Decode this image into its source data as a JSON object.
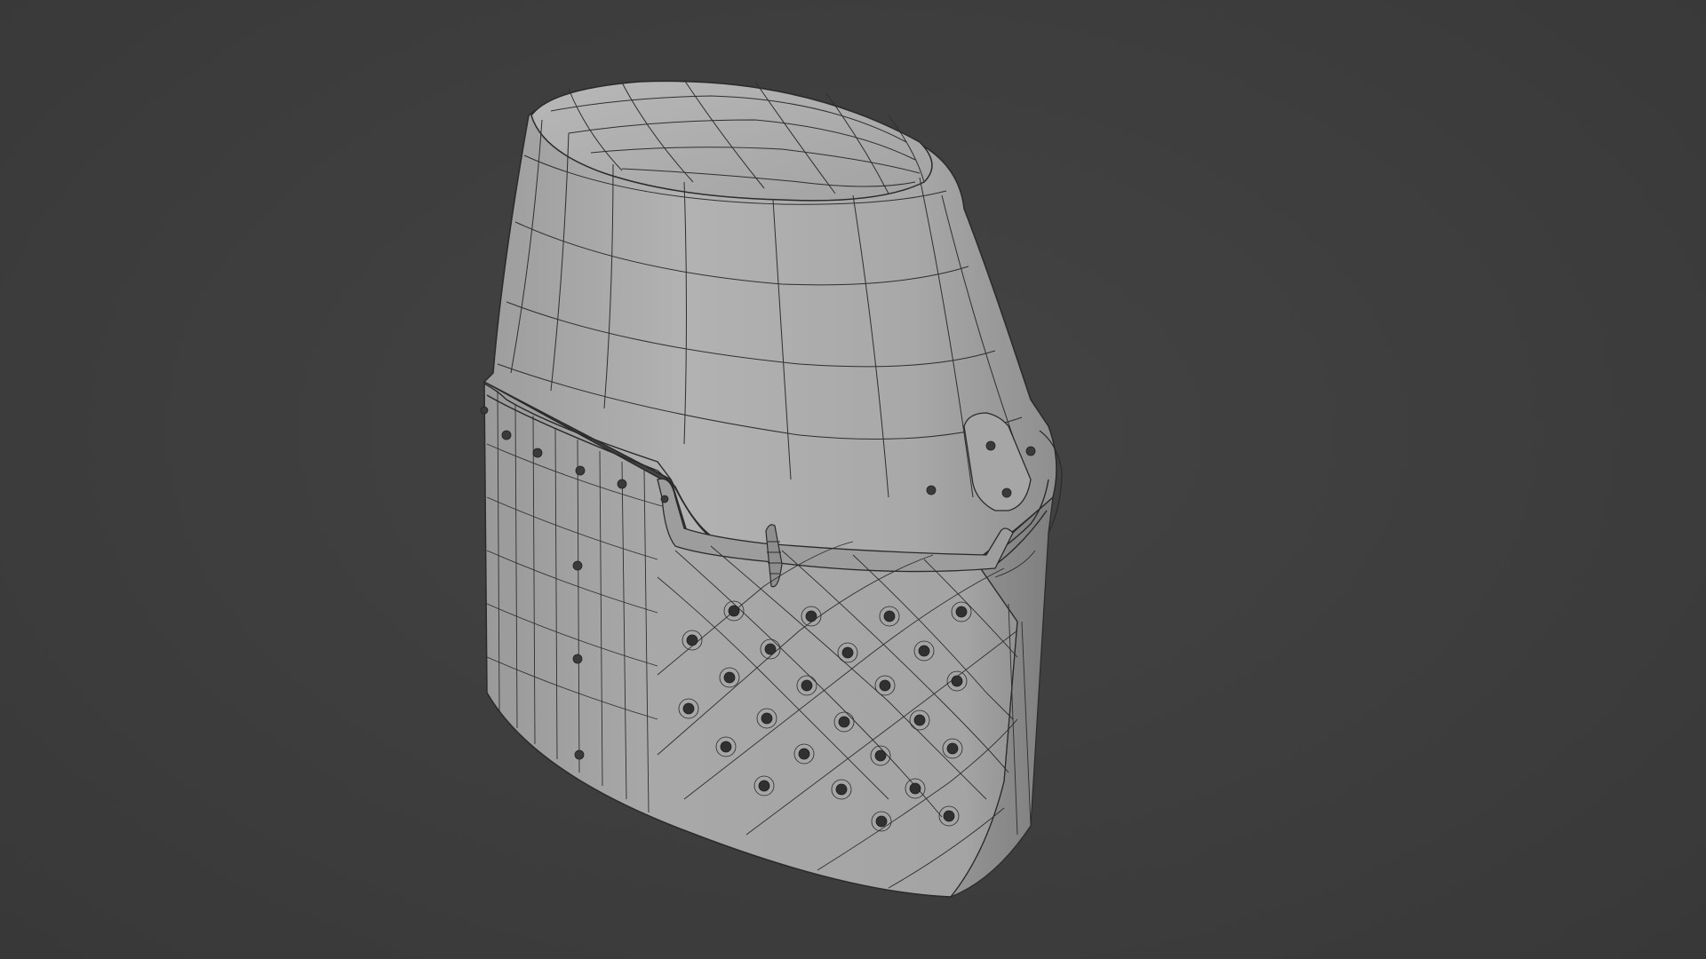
{
  "viewport": {
    "background_color": "#3e3e3e",
    "mode": "solid-wireframe"
  },
  "object": {
    "kind": "great-helm-mesh",
    "surface_color": "#a9a9a9",
    "wire_color": "#2a2a2a",
    "rivet_color": "#3a3a3a"
  }
}
